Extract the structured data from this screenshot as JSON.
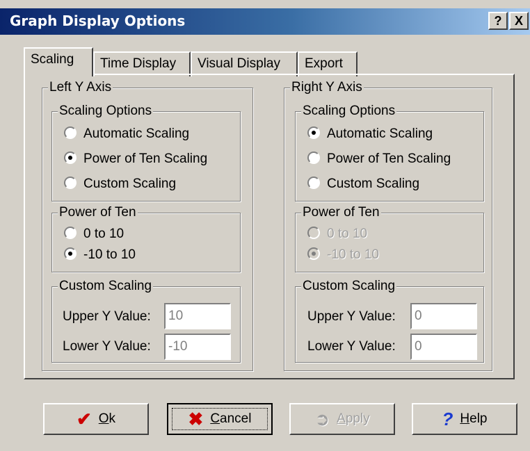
{
  "window": {
    "title": "Graph Display Options",
    "help_btn": "?",
    "close_btn": "X"
  },
  "tabs": [
    "Scaling",
    "Time Display",
    "Visual Display",
    "Export"
  ],
  "left": {
    "title": "Left Y Axis",
    "scaling_options_title": "Scaling Options",
    "options": [
      "Automatic Scaling",
      "Power of Ten Scaling",
      "Custom Scaling"
    ],
    "power_title": "Power of Ten",
    "power_options": [
      "0 to 10",
      "-10 to 10"
    ],
    "custom_title": "Custom Scaling",
    "upper_label": "Upper Y Value:",
    "lower_label": "Lower Y Value:",
    "upper_value": "10",
    "lower_value": "-10"
  },
  "right": {
    "title": "Right Y Axis",
    "scaling_options_title": "Scaling Options",
    "options": [
      "Automatic Scaling",
      "Power of Ten Scaling",
      "Custom Scaling"
    ],
    "power_title": "Power of Ten",
    "power_options": [
      "0 to 10",
      "-10 to 10"
    ],
    "custom_title": "Custom Scaling",
    "upper_label": "Upper Y Value:",
    "lower_label": "Lower Y Value:",
    "upper_value": "0",
    "lower_value": "0"
  },
  "buttons": {
    "ok_rest": "k",
    "ok_mnemonic": "O",
    "cancel_mnemonic": "C",
    "cancel_rest": "ancel",
    "apply_mnemonic": "A",
    "apply_rest": "pply",
    "help_mnemonic": "H",
    "help_rest": "elp"
  },
  "icons": {
    "ok": "✔",
    "cancel": "✖",
    "apply": "➲",
    "help": "?"
  },
  "colors": {
    "ok_icon": "#cc0000",
    "cancel_icon": "#cc0000",
    "help_icon": "#1a3ad0"
  }
}
